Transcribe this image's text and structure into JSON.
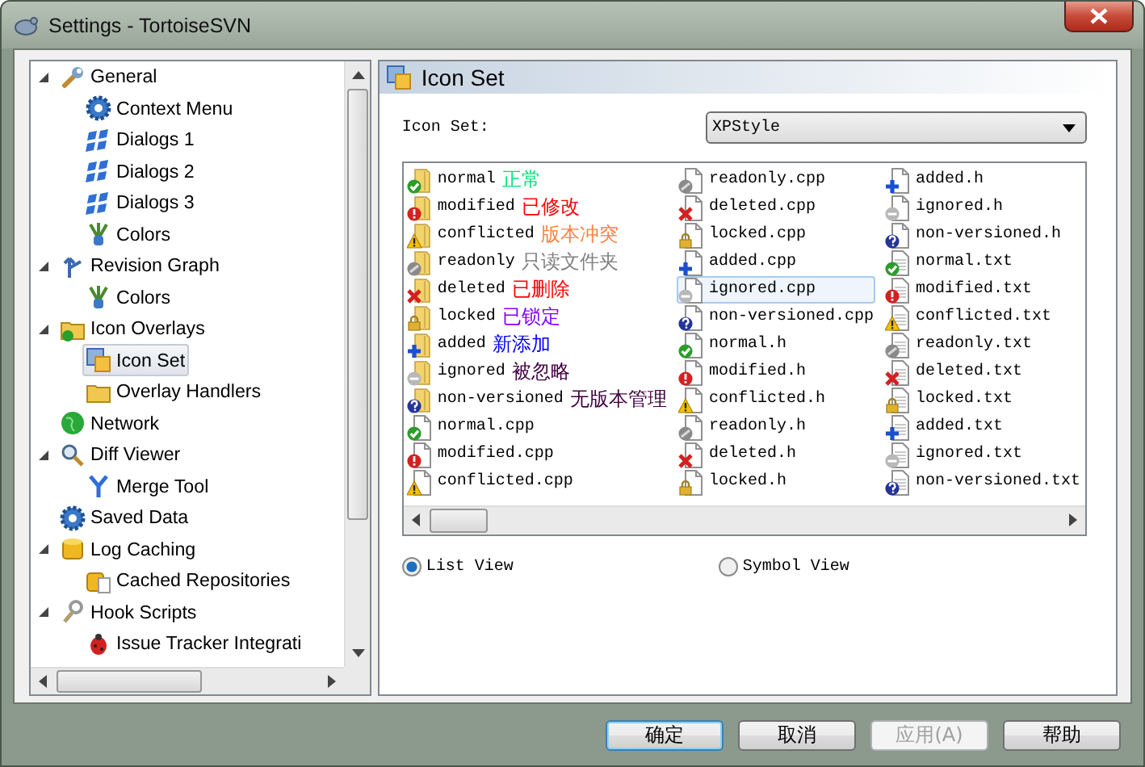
{
  "window": {
    "title": "Settings - TortoiseSVN"
  },
  "tree": [
    {
      "label": "General",
      "selected": false,
      "expanded": true,
      "children": [
        {
          "label": "Context Menu",
          "selected": false
        },
        {
          "label": "Dialogs 1",
          "selected": false
        },
        {
          "label": "Dialogs 2",
          "selected": false
        },
        {
          "label": "Dialogs 3",
          "selected": false
        },
        {
          "label": "Colors",
          "selected": false
        }
      ]
    },
    {
      "label": "Revision Graph",
      "selected": false,
      "expanded": true,
      "children": [
        {
          "label": "Colors",
          "selected": false
        }
      ]
    },
    {
      "label": "Icon Overlays",
      "selected": false,
      "expanded": true,
      "children": [
        {
          "label": "Icon Set",
          "selected": true
        },
        {
          "label": "Overlay Handlers",
          "selected": false
        }
      ]
    },
    {
      "label": "Network",
      "selected": false
    },
    {
      "label": "Diff Viewer",
      "selected": false,
      "expanded": true,
      "children": [
        {
          "label": "Merge Tool",
          "selected": false
        }
      ]
    },
    {
      "label": "Saved Data",
      "selected": false
    },
    {
      "label": "Log Caching",
      "selected": false,
      "expanded": true,
      "children": [
        {
          "label": "Cached Repositories",
          "selected": false
        }
      ]
    },
    {
      "label": "Hook Scripts",
      "selected": false,
      "expanded": true,
      "children": [
        {
          "label": "Issue Tracker Integrati",
          "selected": false
        }
      ]
    }
  ],
  "panel": {
    "title": "Icon Set",
    "icon_set_label": "Icon Set:",
    "icon_set_value": "XPStyle",
    "groups": [
      {
        "kind": "folder",
        "items": [
          {
            "label": "normal",
            "note": {
              "text": "正常",
              "color": "#00e676"
            },
            "kind": "normal",
            "selected": false
          },
          {
            "label": "modified",
            "note": {
              "text": "已修改",
              "color": "#ff0000"
            },
            "kind": "modified",
            "selected": false
          },
          {
            "label": "conflicted",
            "note": {
              "text": "版本冲突",
              "color": "#ff8040"
            },
            "kind": "conflicted",
            "selected": false
          },
          {
            "label": "readonly",
            "note": {
              "text": "只读文件夹",
              "color": "#808080"
            },
            "kind": "readonly",
            "selected": false
          },
          {
            "label": "deleted",
            "note": {
              "text": "已删除",
              "color": "#ff0000"
            },
            "kind": "deleted",
            "selected": false
          },
          {
            "label": "locked",
            "note": {
              "text": "已锁定",
              "color": "#8000ff"
            },
            "kind": "locked",
            "selected": false
          },
          {
            "label": "added",
            "note": {
              "text": "新添加",
              "color": "#0000ff"
            },
            "kind": "added",
            "selected": false
          },
          {
            "label": "ignored",
            "note": {
              "text": "被忽略",
              "color": "#400040"
            },
            "kind": "ignored",
            "selected": false
          },
          {
            "label": "non-versioned",
            "note": {
              "text": "无版本管理",
              "color": "#400040"
            },
            "kind": "nonversioned",
            "selected": false
          }
        ]
      },
      {
        "kind": "file",
        "items": [
          {
            "label": "normal.cpp",
            "kind": "normal",
            "selected": false
          },
          {
            "label": "modified.cpp",
            "kind": "modified",
            "selected": false
          },
          {
            "label": "conflicted.cpp",
            "kind": "conflicted",
            "selected": false
          },
          {
            "label": "readonly.cpp",
            "kind": "readonly",
            "selected": false
          },
          {
            "label": "deleted.cpp",
            "kind": "deleted",
            "selected": false
          },
          {
            "label": "locked.cpp",
            "kind": "locked",
            "selected": false
          },
          {
            "label": "added.cpp",
            "kind": "added",
            "selected": false
          },
          {
            "label": "ignored.cpp",
            "kind": "ignored",
            "selected": true
          },
          {
            "label": "non-versioned.cpp",
            "kind": "nonversioned",
            "selected": false
          },
          {
            "label": "normal.h",
            "kind": "normal",
            "selected": false
          },
          {
            "label": "modified.h",
            "kind": "modified",
            "selected": false
          },
          {
            "label": "conflicted.h",
            "kind": "conflicted",
            "selected": false
          },
          {
            "label": "readonly.h",
            "kind": "readonly",
            "selected": false
          },
          {
            "label": "deleted.h",
            "kind": "deleted",
            "selected": false
          },
          {
            "label": "locked.h",
            "kind": "locked",
            "selected": false
          },
          {
            "label": "added.h",
            "kind": "added",
            "selected": false
          },
          {
            "label": "ignored.h",
            "kind": "ignored",
            "selected": false
          },
          {
            "label": "non-versioned.h",
            "kind": "nonversioned",
            "selected": false
          }
        ]
      },
      {
        "kind": "text",
        "items": [
          {
            "label": "normal.txt",
            "kind": "normal",
            "selected": false
          },
          {
            "label": "modified.txt",
            "kind": "modified",
            "selected": false
          },
          {
            "label": "conflicted.txt",
            "kind": "conflicted",
            "selected": false
          },
          {
            "label": "readonly.txt",
            "kind": "readonly",
            "selected": false
          },
          {
            "label": "deleted.txt",
            "kind": "deleted",
            "selected": false
          },
          {
            "label": "locked.txt",
            "kind": "locked",
            "selected": false
          },
          {
            "label": "added.txt",
            "kind": "added",
            "selected": false
          },
          {
            "label": "ignored.txt",
            "kind": "ignored",
            "selected": false
          },
          {
            "label": "non-versioned.txt",
            "kind": "nonversioned",
            "selected": false
          }
        ]
      }
    ],
    "views": [
      {
        "label": "List View",
        "selected": true
      },
      {
        "label": "Symbol View",
        "selected": false
      }
    ]
  },
  "buttons": [
    {
      "label": "确定",
      "default": true,
      "disabled": false
    },
    {
      "label": "取消",
      "default": false,
      "disabled": false
    },
    {
      "label": "应用(A)",
      "default": false,
      "disabled": true
    },
    {
      "label": "帮助",
      "default": false,
      "disabled": false
    }
  ]
}
